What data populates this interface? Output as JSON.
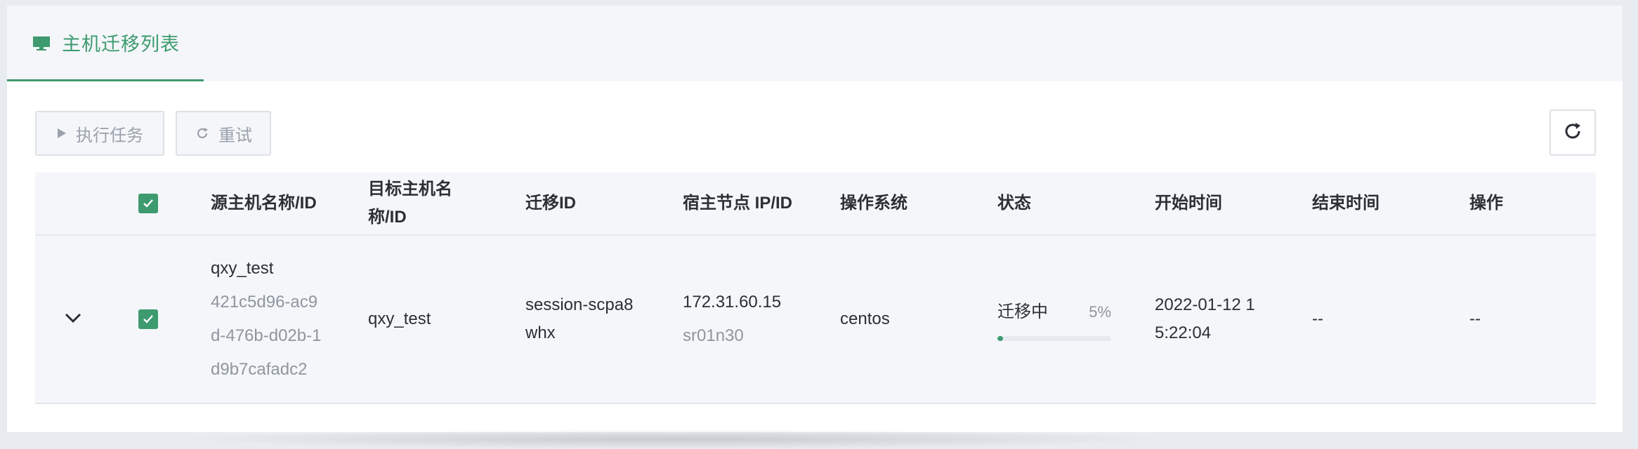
{
  "tab": {
    "label": "主机迁移列表",
    "icon": "monitor-icon"
  },
  "toolbar": {
    "run_label": "执行任务",
    "retry_label": "重试",
    "refresh_icon": "refresh-icon"
  },
  "table": {
    "headers": {
      "source": "源主机名称/ID",
      "target_line1": "目标主机名",
      "target_line2": "称/ID",
      "migration_id": "迁移ID",
      "host_node": "宿主节点 IP/ID",
      "os": "操作系统",
      "status": "状态",
      "start_time": "开始时间",
      "end_time": "结束时间",
      "actions": "操作"
    },
    "rows": [
      {
        "source_name": "qxy_test",
        "source_id_1": "421c5d96-ac9",
        "source_id_2": "d-476b-d02b-1",
        "source_id_3": "d9b7cafadc2",
        "target_name": "qxy_test",
        "migration_id_1": "session-scpa8",
        "migration_id_2": "whx",
        "host_ip": "172.31.60.15",
        "host_id": "sr01n30",
        "os": "centos",
        "status": "迁移中",
        "progress_text": "5%",
        "progress": 0.05,
        "start_1": "2022-01-12 1",
        "start_2": "5:22:04",
        "end": "--",
        "actions": "--"
      }
    ]
  },
  "colors": {
    "accent": "#3d9b6f",
    "muted": "#8f96a0"
  }
}
